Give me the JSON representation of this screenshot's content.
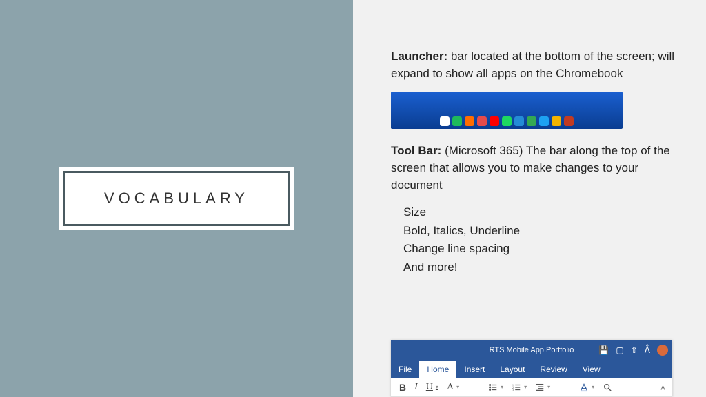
{
  "left": {
    "title": "VOCABULARY"
  },
  "right": {
    "launcher_term": "Launcher:",
    "launcher_def": " bar located at the bottom of the screen; will expand to show all apps on the Chromebook",
    "toolbar_term": "Tool Bar:",
    "toolbar_def": " (Microsoft 365) The bar along the top of the screen that allows you to make changes to your document",
    "bullets": [
      "Size",
      "Bold, Italics, Underline",
      "Change line spacing",
      "And more!"
    ]
  },
  "shelf_icons": [
    {
      "name": "chrome",
      "c": "#fff"
    },
    {
      "name": "play",
      "c": "#1fba5b"
    },
    {
      "name": "files",
      "c": "#ff6d00"
    },
    {
      "name": "gmail",
      "c": "#e54b4b"
    },
    {
      "name": "youtube",
      "c": "#ff0000"
    },
    {
      "name": "spotify",
      "c": "#1ed760"
    },
    {
      "name": "app1",
      "c": "#248bd6"
    },
    {
      "name": "app2",
      "c": "#34a853"
    },
    {
      "name": "twitter",
      "c": "#1da1f2"
    },
    {
      "name": "app3",
      "c": "#f4b400"
    },
    {
      "name": "app4",
      "c": "#c23b22"
    }
  ],
  "word": {
    "doc_title": "RTS Mobile App Portfolio",
    "tabs": [
      "File",
      "Home",
      "Insert",
      "Layout",
      "Review",
      "View"
    ],
    "active_tab": 1,
    "toolbar_letters": {
      "b": "B",
      "i": "I",
      "u": "U",
      "a": "A"
    }
  }
}
